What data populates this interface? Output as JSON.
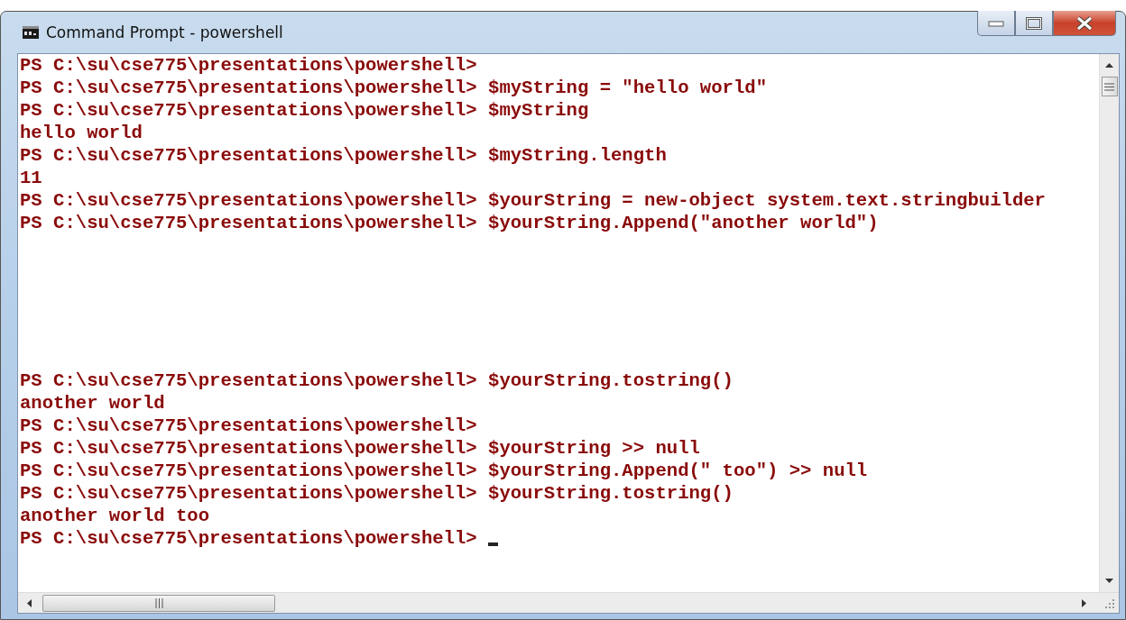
{
  "window": {
    "title": "Command Prompt - powershell"
  },
  "console": {
    "lines": [
      {
        "kind": "text",
        "text": "PS C:\\su\\cse775\\presentations\\powershell>"
      },
      {
        "kind": "text",
        "text": "PS C:\\su\\cse775\\presentations\\powershell> $myString = \"hello world\""
      },
      {
        "kind": "text",
        "text": "PS C:\\su\\cse775\\presentations\\powershell> $myString"
      },
      {
        "kind": "text",
        "text": "hello world"
      },
      {
        "kind": "text",
        "text": "PS C:\\su\\cse775\\presentations\\powershell> $myString.length"
      },
      {
        "kind": "text",
        "text": "11"
      },
      {
        "kind": "text",
        "text": "PS C:\\su\\cse775\\presentations\\powershell> $yourString = new-object system.text.stringbuilder"
      },
      {
        "kind": "text",
        "text": "PS C:\\su\\cse775\\presentations\\powershell> $yourString.Append(\"another world\")"
      },
      {
        "kind": "blank"
      },
      {
        "kind": "blank"
      },
      {
        "kind": "blank"
      },
      {
        "kind": "blank"
      },
      {
        "kind": "blank"
      },
      {
        "kind": "blank"
      },
      {
        "kind": "text",
        "text": "PS C:\\su\\cse775\\presentations\\powershell> $yourString.tostring()"
      },
      {
        "kind": "text",
        "text": "another world"
      },
      {
        "kind": "text",
        "text": "PS C:\\su\\cse775\\presentations\\powershell>"
      },
      {
        "kind": "text",
        "text": "PS C:\\su\\cse775\\presentations\\powershell> $yourString >> null"
      },
      {
        "kind": "text",
        "text": "PS C:\\su\\cse775\\presentations\\powershell> $yourString.Append(\" too\") >> null"
      },
      {
        "kind": "text",
        "text": "PS C:\\su\\cse775\\presentations\\powershell> $yourString.tostring()"
      },
      {
        "kind": "text",
        "text": "another world too"
      },
      {
        "kind": "cursor",
        "text": "PS C:\\su\\cse775\\presentations\\powershell> "
      }
    ]
  }
}
